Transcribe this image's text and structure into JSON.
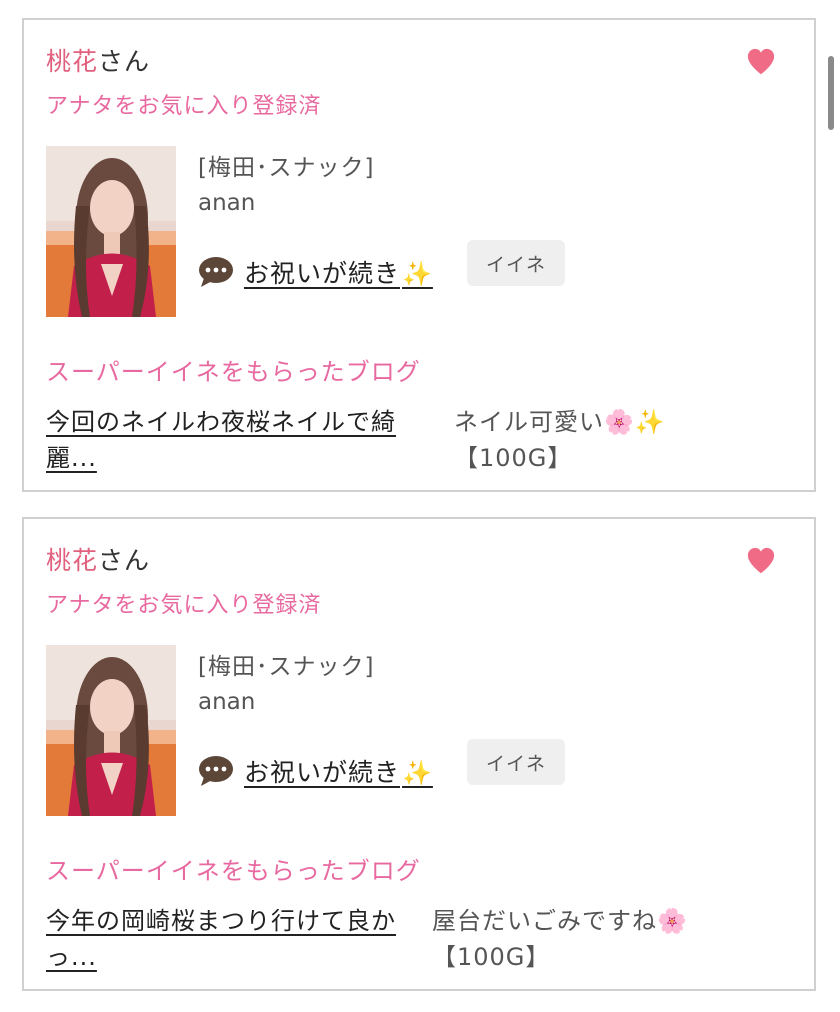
{
  "cards": [
    {
      "user_name": "桃花",
      "user_suffix": "さん",
      "fav_status": "アナタをお気に入り登録済",
      "shop": "[梅田･スナック]",
      "cast_name": "anan",
      "blog_title": "お祝いが続き",
      "blog_emoji": "✨",
      "like_label": "イイネ",
      "super_like_title": "スーパーイイネをもらったブログ",
      "post_title": "今回のネイルわ夜桜ネイルで綺麗...",
      "comment_text": "ネイル可愛い",
      "comment_emoji1": "🌸",
      "comment_emoji2": "✨",
      "comment_points": "【100G】"
    },
    {
      "user_name": "桃花",
      "user_suffix": "さん",
      "fav_status": "アナタをお気に入り登録済",
      "shop": "[梅田･スナック]",
      "cast_name": "anan",
      "blog_title": "お祝いが続き",
      "blog_emoji": "✨",
      "like_label": "イイネ",
      "super_like_title": "スーパーイイネをもらったブログ",
      "post_title": "今年の岡崎桜まつり行けて良かっ...",
      "comment_text": "屋台だいごみですね",
      "comment_emoji1": "🌸",
      "comment_points": "【100G】"
    }
  ],
  "colors": {
    "accent_pink": "#e869a0",
    "heart": "#f06b86",
    "name_pink": "#e0607e"
  }
}
